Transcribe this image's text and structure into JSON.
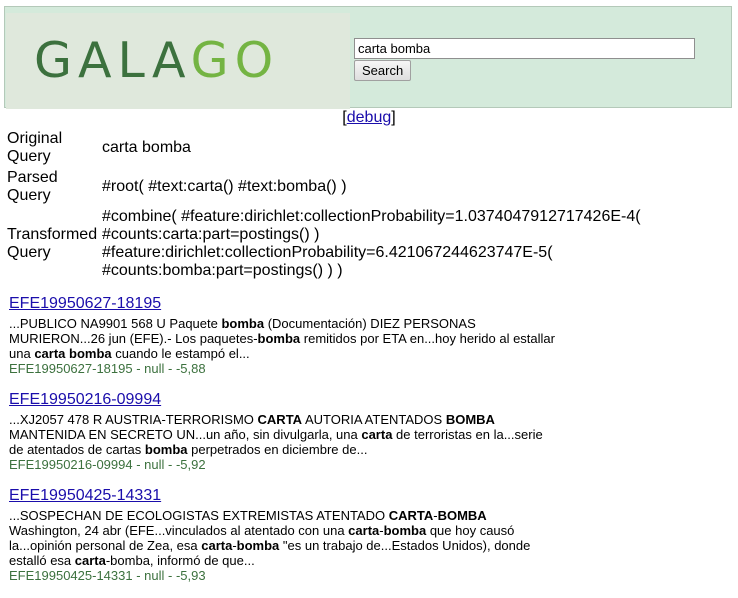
{
  "header": {
    "logo_text": "GALAGO",
    "search_value": "carta bomba",
    "search_button": "Search"
  },
  "debug": {
    "prefix": "[",
    "link": "debug",
    "suffix": "]"
  },
  "query_info": [
    {
      "label_1": "Original",
      "label_2": "Query",
      "value": "carta bomba"
    },
    {
      "label_1": "Parsed",
      "label_2": "Query",
      "value": "#root( #text:carta() #text:bomba() )"
    },
    {
      "label_1": "Transformed",
      "label_2": "Query",
      "lines": [
        "#combine( #feature:dirichlet:collectionProbability=1.0374047912717426E-4(",
        "#counts:carta:part=postings() )",
        "#feature:dirichlet:collectionProbability=6.421067244623747E-5(",
        "#counts:bomba:part=postings() ) )"
      ]
    }
  ],
  "results": [
    {
      "title": "EFE19950627-18195",
      "snippet_lines": [
        [
          {
            "t": "...PUBLICO NA9901 568 U Paquete ",
            "b": false
          },
          {
            "t": "bomba",
            "b": true
          },
          {
            "t": " (Documentación) DIEZ PERSONAS",
            "b": false
          }
        ],
        [
          {
            "t": "MURIERON...26 jun (EFE).- Los paquetes-",
            "b": false
          },
          {
            "t": "bomba",
            "b": true
          },
          {
            "t": " remitidos por ETA en...hoy herido al estallar",
            "b": false
          }
        ],
        [
          {
            "t": "una ",
            "b": false
          },
          {
            "t": "carta bomba",
            "b": true
          },
          {
            "t": " cuando le estampó el...",
            "b": false
          }
        ]
      ],
      "meta": "EFE19950627-18195 - null - -5,88"
    },
    {
      "title": "EFE19950216-09994",
      "snippet_lines": [
        [
          {
            "t": "...XJ2057 478 R AUSTRIA-TERRORISMO ",
            "b": false
          },
          {
            "t": "CARTA",
            "b": true
          },
          {
            "t": " AUTORIA ATENTADOS ",
            "b": false
          },
          {
            "t": "BOMBA",
            "b": true
          }
        ],
        [
          {
            "t": "MANTENIDA EN SECRETO UN...un año, sin divulgarla, una ",
            "b": false
          },
          {
            "t": "carta",
            "b": true
          },
          {
            "t": " de terroristas en la...serie",
            "b": false
          }
        ],
        [
          {
            "t": "de atentados de cartas ",
            "b": false
          },
          {
            "t": "bomba",
            "b": true
          },
          {
            "t": " perpetrados en diciembre de...",
            "b": false
          }
        ]
      ],
      "meta": "EFE19950216-09994 - null - -5,92"
    },
    {
      "title": "EFE19950425-14331",
      "snippet_lines": [
        [
          {
            "t": "...SOSPECHAN DE ECOLOGISTAS EXTREMISTAS ATENTADO ",
            "b": false
          },
          {
            "t": "CARTA",
            "b": true
          },
          {
            "t": "-",
            "b": false
          },
          {
            "t": "BOMBA",
            "b": true
          }
        ],
        [
          {
            "t": "Washington, 24 abr (EFE...vinculados al atentado con una ",
            "b": false
          },
          {
            "t": "carta",
            "b": true
          },
          {
            "t": "-",
            "b": false
          },
          {
            "t": "bomba",
            "b": true
          },
          {
            "t": " que hoy causó",
            "b": false
          }
        ],
        [
          {
            "t": "la...opinión personal de Zea, esa ",
            "b": false
          },
          {
            "t": "carta",
            "b": true
          },
          {
            "t": "-",
            "b": false
          },
          {
            "t": "bomba",
            "b": true
          },
          {
            "t": " \"es un trabajo de...Estados Unidos), donde",
            "b": false
          }
        ],
        [
          {
            "t": "estalló esa ",
            "b": false
          },
          {
            "t": "carta",
            "b": true
          },
          {
            "t": "-bomba, informó de que...",
            "b": false
          }
        ]
      ],
      "meta": "EFE19950425-14331 - null - -5,93"
    }
  ]
}
